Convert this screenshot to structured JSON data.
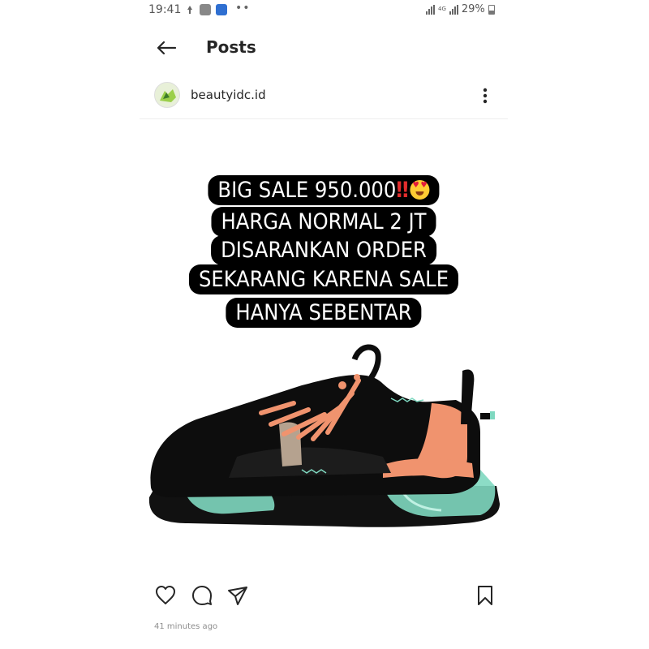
{
  "status_bar": {
    "time": "19:41",
    "network": "4G",
    "battery": "29%"
  },
  "header": {
    "title": "Posts"
  },
  "post": {
    "username": "beautyidc.id",
    "caption_lines": [
      "BIG SALE 950.000",
      "HARGA NORMAL 2 JT",
      "DISARANKAN ORDER",
      "SEKARANG KARENA SALE",
      "HANYA SEBENTAR"
    ],
    "timestamp": "41 minutes ago"
  },
  "icons": {
    "back": "arrow-left-icon",
    "more": "more-vertical-icon",
    "like": "heart-icon",
    "comment": "comment-icon",
    "share": "send-icon",
    "save": "bookmark-icon"
  },
  "colors": {
    "caption_bg": "#000000",
    "caption_text": "#ffffff",
    "shoe_accent_orange": "#f0936e",
    "shoe_accent_teal": "#7fd8c0"
  }
}
